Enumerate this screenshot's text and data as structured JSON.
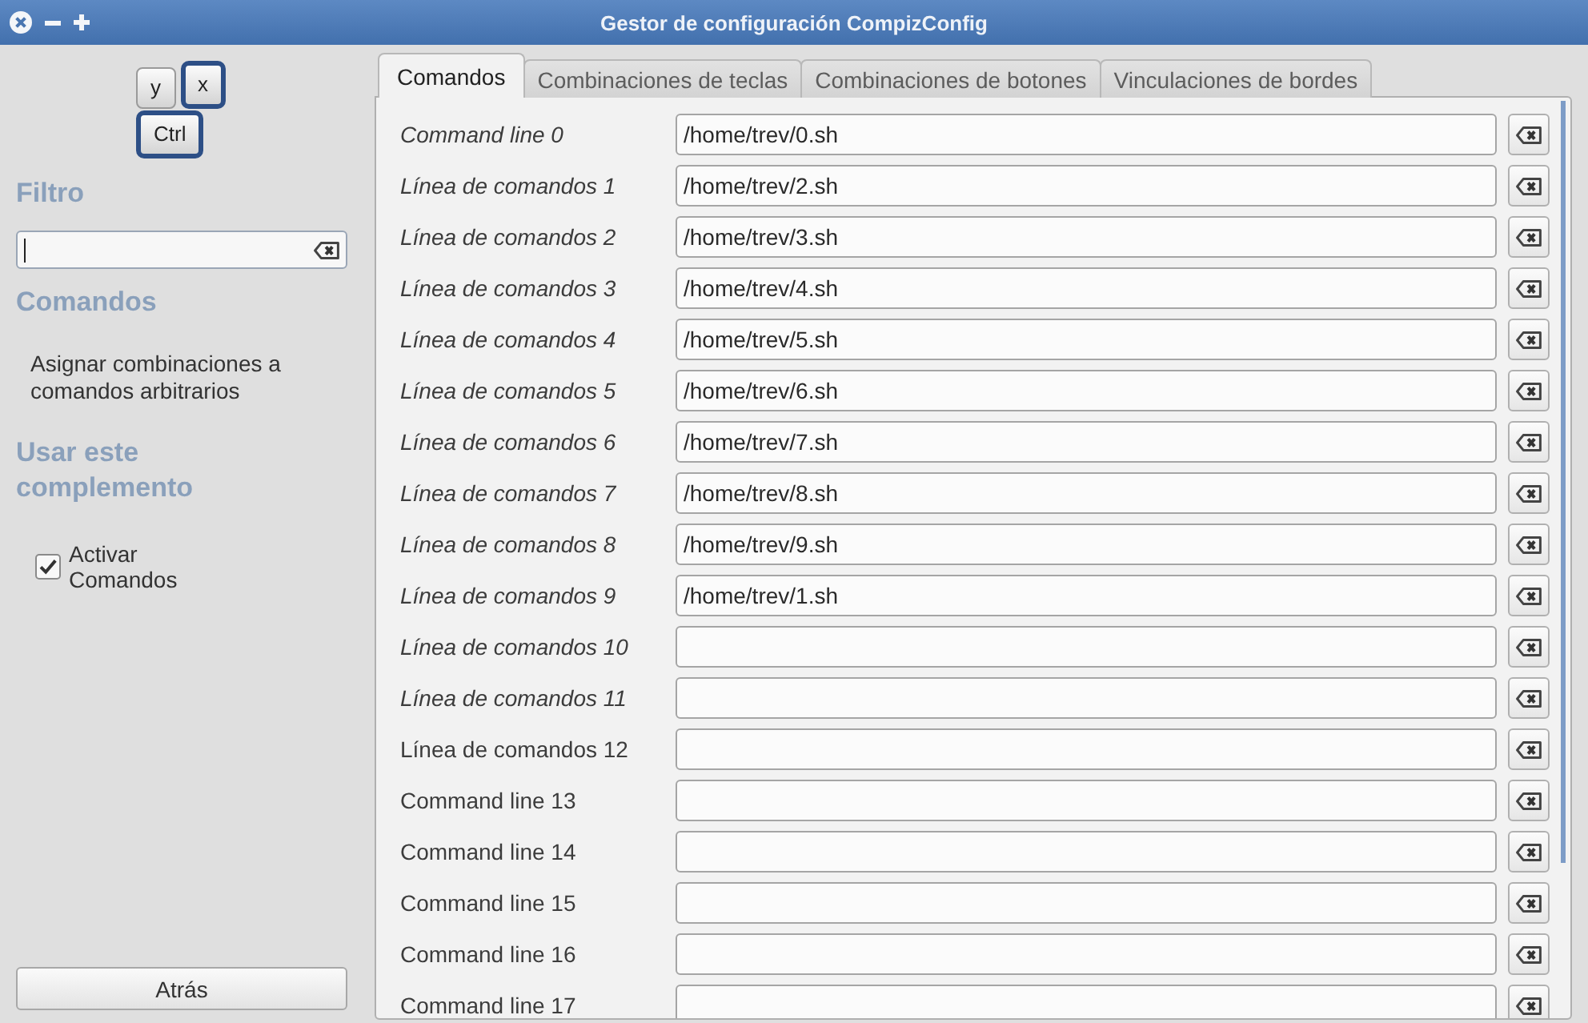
{
  "window": {
    "title": "Gestor de configuración CompizConfig"
  },
  "sidebar": {
    "keys": [
      {
        "label": "y",
        "highlighted": false
      },
      {
        "label": "x",
        "highlighted": true
      },
      {
        "label": "Ctrl",
        "highlighted": true
      }
    ],
    "filter": {
      "heading": "Filtro",
      "focused": true
    },
    "plugin": {
      "heading": "Comandos",
      "description": "Asignar combinaciones a comandos arbitrarios"
    },
    "enable": {
      "heading": "Usar este complemento",
      "checkbox": {
        "label": "Activar Comandos",
        "checked": true
      }
    },
    "back_button": "Atrás"
  },
  "tabs": [
    {
      "label": "Comandos",
      "selected": true
    },
    {
      "label": "Combinaciones de teclas",
      "selected": false
    },
    {
      "label": "Combinaciones de botones",
      "selected": false
    },
    {
      "label": "Vinculaciones de bordes",
      "selected": false
    }
  ],
  "commands": [
    {
      "label": "Command line 0",
      "value": "/home/trev/0.sh",
      "modified": true
    },
    {
      "label": "Línea de comandos 1",
      "value": "/home/trev/2.sh",
      "modified": true
    },
    {
      "label": "Línea de comandos 2",
      "value": "/home/trev/3.sh",
      "modified": true
    },
    {
      "label": "Línea de comandos 3",
      "value": "/home/trev/4.sh",
      "modified": true
    },
    {
      "label": "Línea de comandos 4",
      "value": "/home/trev/5.sh",
      "modified": true
    },
    {
      "label": "Línea de comandos 5",
      "value": "/home/trev/6.sh",
      "modified": true
    },
    {
      "label": "Línea de comandos 6",
      "value": "/home/trev/7.sh",
      "modified": true
    },
    {
      "label": "Línea de comandos 7",
      "value": "/home/trev/8.sh",
      "modified": true
    },
    {
      "label": "Línea de comandos 8",
      "value": "/home/trev/9.sh",
      "modified": true
    },
    {
      "label": "Línea de comandos 9",
      "value": "/home/trev/1.sh",
      "modified": true
    },
    {
      "label": "Línea de comandos 10",
      "modified": true
    },
    {
      "label": "Línea de comandos 11",
      "modified": true
    },
    {
      "label": "Línea de comandos 12",
      "modified": false
    },
    {
      "label": "Command line 13",
      "modified": false
    },
    {
      "label": "Command line 14",
      "modified": false
    },
    {
      "label": "Command line 15",
      "modified": false
    },
    {
      "label": "Command line 16",
      "modified": false
    },
    {
      "label": "Command line 17",
      "modified": false
    }
  ]
}
